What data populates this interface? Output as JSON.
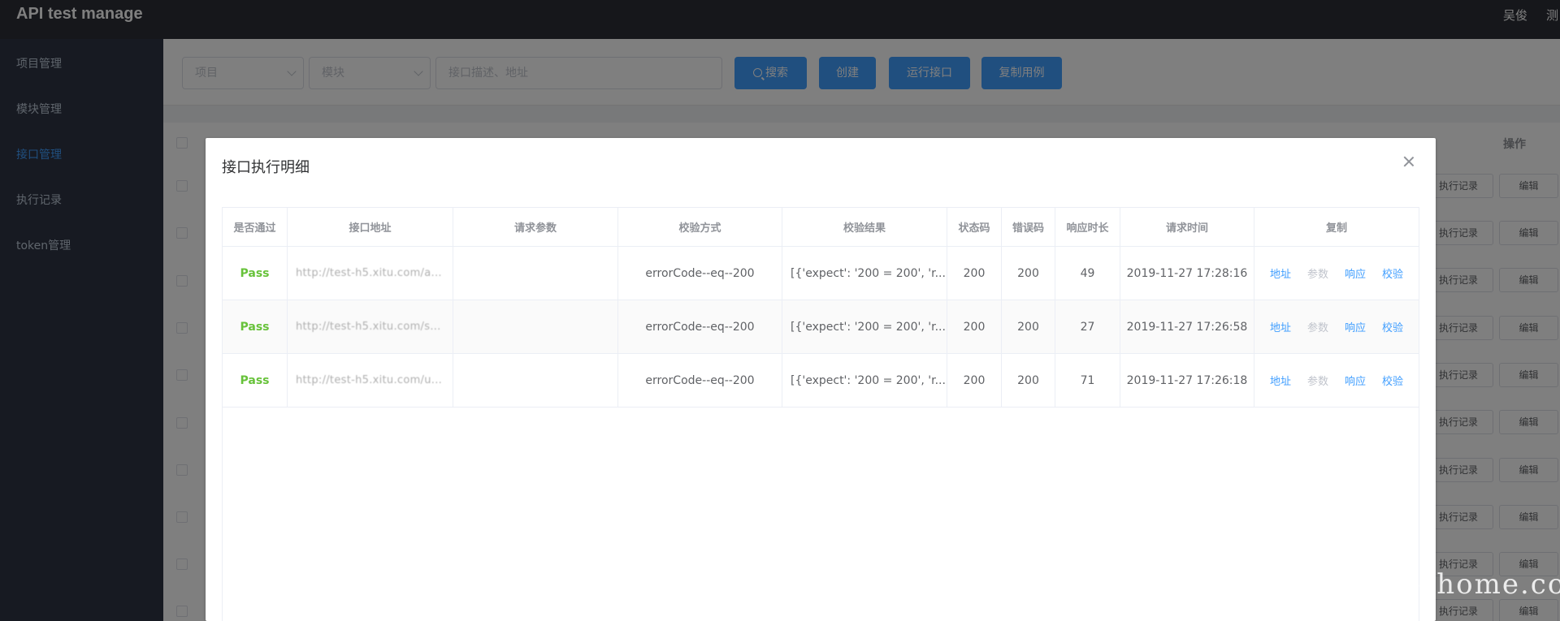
{
  "header": {
    "app_title": "API test manage",
    "user_name": "吴俊",
    "user_extra": "测"
  },
  "sidebar": {
    "items": [
      {
        "label": "项目管理",
        "active": false
      },
      {
        "label": "模块管理",
        "active": false
      },
      {
        "label": "接口管理",
        "active": true
      },
      {
        "label": "执行记录",
        "active": false
      },
      {
        "label": "token管理",
        "active": false
      }
    ]
  },
  "toolbar": {
    "project_placeholder": "项目",
    "module_placeholder": "模块",
    "search_placeholder": "接口描述、地址",
    "search_label": "搜索",
    "create_label": "创建",
    "run_label": "运行接口",
    "copy_label": "复制用例"
  },
  "background_table": {
    "operation_header": "操作",
    "row_buttons": {
      "record": "执行记录",
      "edit": "编辑"
    }
  },
  "dialog": {
    "title": "接口执行明细",
    "columns": [
      "是否通过",
      "接口地址",
      "请求参数",
      "校验方式",
      "校验结果",
      "状态码",
      "错误码",
      "响应时长",
      "请求时间",
      "复制"
    ],
    "rows": [
      {
        "passed": "Pass",
        "url": "http://test-h5.xitu.com/a...",
        "params": "",
        "check_method": "errorCode--eq--200",
        "check_result": "[{'expect': '200 = 200', 'r...",
        "status_code": "200",
        "error_code": "200",
        "response_time": "49",
        "request_time": "2019-11-27 17:28:16"
      },
      {
        "passed": "Pass",
        "url": "http://test-h5.xitu.com/s...",
        "params": "",
        "check_method": "errorCode--eq--200",
        "check_result": "[{'expect': '200 = 200', 'r...",
        "status_code": "200",
        "error_code": "200",
        "response_time": "27",
        "request_time": "2019-11-27 17:26:58"
      },
      {
        "passed": "Pass",
        "url": "http://test-h5.xitu.com/u...",
        "params": "",
        "check_method": "errorCode--eq--200",
        "check_result": "[{'expect': '200 = 200', 'r...",
        "status_code": "200",
        "error_code": "200",
        "response_time": "71",
        "request_time": "2019-11-27 17:26:18"
      }
    ],
    "copy_links": {
      "address": "地址",
      "params": "参数",
      "response": "响应",
      "check": "校验"
    }
  },
  "watermark": "testerhome.com",
  "colors": {
    "primary": "#409eff",
    "success": "#67c23a",
    "header_bg": "#2d2f37",
    "sidebar_bg": "#2f3544"
  },
  "icons": [
    "search-icon",
    "chevron-down-icon",
    "close-icon",
    "edit-icon",
    "checkbox-icon"
  ]
}
